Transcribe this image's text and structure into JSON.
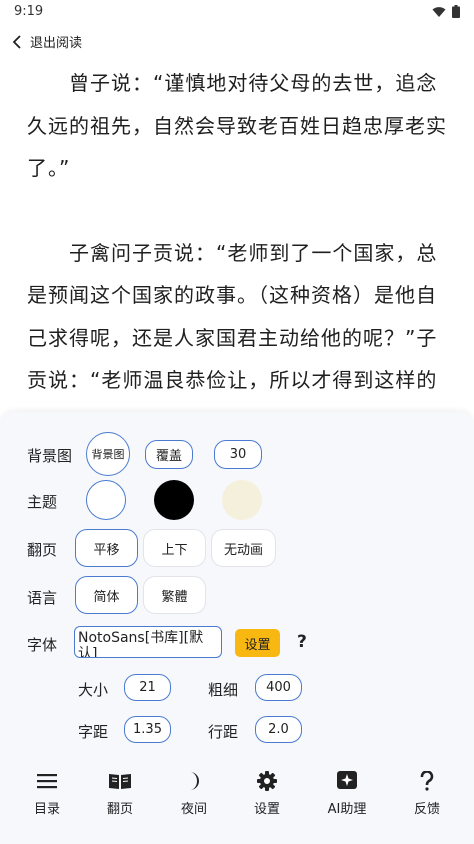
{
  "status": {
    "time": "9:19"
  },
  "topbar": {
    "back_label": "退出阅读"
  },
  "reader": {
    "paragraphs": [
      "曾子说：“谨慎地对待父母的去世，追念久远的祖先，自然会导致老百姓日趋忠厚老实了。”",
      "子禽问子贡说：“老师到了一个国家，总是预闻这个国家的政事。（这种资格）是他自己求得呢，还是人家国君主动给他的呢？”子贡说：“老师温良恭俭让，所以才得到这样的资格。（这种资格也可以说是求得"
    ]
  },
  "settings": {
    "background": {
      "label": "背景图",
      "chips": [
        "背景图",
        "覆盖",
        "30"
      ]
    },
    "theme": {
      "label": "主题",
      "colors": [
        "#ffffff",
        "#000000",
        "#f5f0dc"
      ]
    },
    "page_turn": {
      "label": "翻页",
      "options": [
        "平移",
        "上下",
        "无动画"
      ]
    },
    "language": {
      "label": "语言",
      "options": [
        "简体",
        "繁體"
      ]
    },
    "font": {
      "label": "字体",
      "value": "NotoSans[书库][默认]",
      "set_label": "设置",
      "help": "?"
    },
    "size": {
      "label": "大小",
      "value": "21"
    },
    "weight": {
      "label": "粗细",
      "value": "400"
    },
    "letter_spacing": {
      "label": "字距",
      "value": "1.35"
    },
    "line_spacing": {
      "label": "行距",
      "value": "2.0"
    }
  },
  "nav": [
    {
      "label": "目录",
      "icon": "menu-icon"
    },
    {
      "label": "翻页",
      "icon": "book-icon"
    },
    {
      "label": "夜间",
      "icon": "moon-icon"
    },
    {
      "label": "设置",
      "icon": "gear-icon"
    },
    {
      "label": "AI助理",
      "icon": "ai-sparkle-icon"
    },
    {
      "label": "反馈",
      "icon": "question-icon"
    }
  ]
}
